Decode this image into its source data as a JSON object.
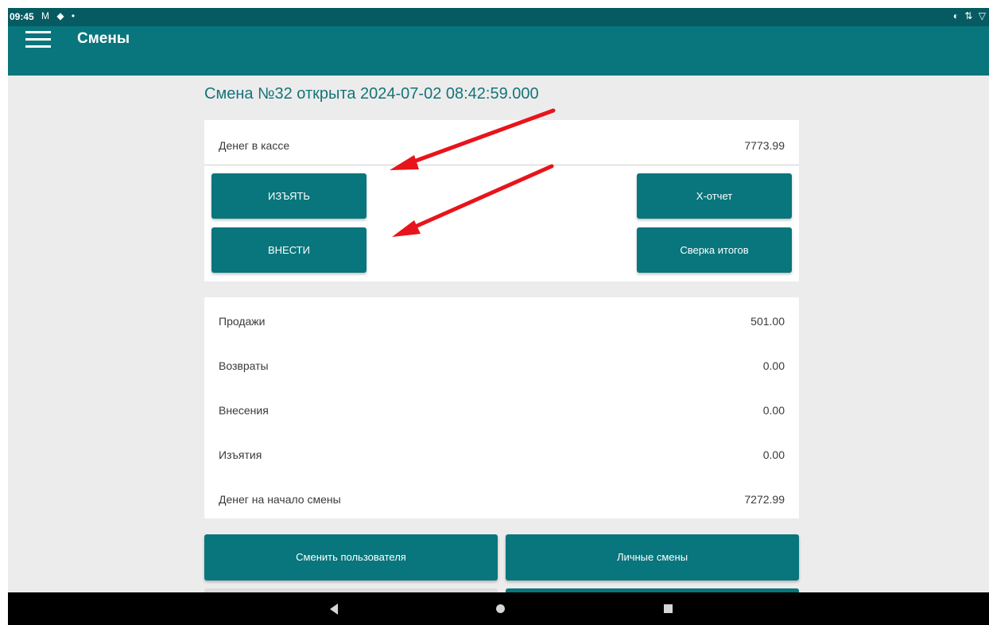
{
  "status_bar": {
    "time": "09:45",
    "left_icons": "M ◆ •",
    "right_icons": "◐ ⇅ ▽"
  },
  "app_bar": {
    "menu_icon": "hamburger-menu-icon",
    "title": "Смены"
  },
  "shift": {
    "title": "Смена №32 открыта 2024-07-02 08:42:59.000"
  },
  "cash_card": {
    "label": "Денег в кассе",
    "value": "7773.99",
    "buttons": {
      "withdraw": "ИЗЪЯТЬ",
      "deposit": "ВНЕСТИ",
      "x_report": "Х-отчет",
      "reconciliation": "Сверка итогов"
    }
  },
  "summary": [
    {
      "label": "Продажи",
      "value": "501.00"
    },
    {
      "label": "Возвраты",
      "value": "0.00"
    },
    {
      "label": "Внесения",
      "value": "0.00"
    },
    {
      "label": "Изъятия",
      "value": "0.00"
    },
    {
      "label": "Денег на начало смены",
      "value": "7272.99"
    }
  ],
  "bottom_buttons": {
    "change_user": "Сменить пользователя",
    "personal_shifts": "Личные смены"
  },
  "colors": {
    "primary": "#08767c",
    "status_bar": "#055b61",
    "title_text": "#157479",
    "annotation_arrow": "#e8141b",
    "background": "#ececec"
  },
  "nav_bar": {
    "back_icon": "back-triangle-icon",
    "home_icon": "home-circle-icon",
    "recent_icon": "recent-apps-square-icon"
  }
}
